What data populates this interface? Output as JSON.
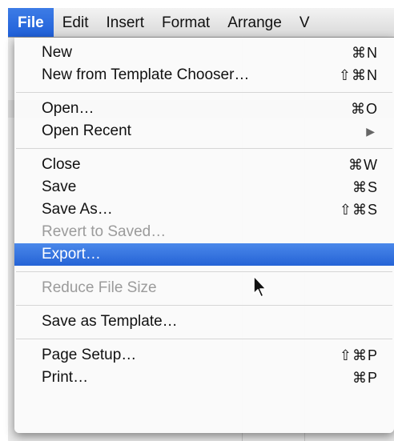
{
  "menubar": {
    "items": [
      "File",
      "Edit",
      "Insert",
      "Format",
      "Arrange",
      "V"
    ],
    "active_index": 0
  },
  "file_menu": {
    "groups": [
      [
        {
          "label": "New",
          "shortcut": "⌘N",
          "enabled": true
        },
        {
          "label": "New from Template Chooser…",
          "shortcut": "⇧⌘N",
          "enabled": true
        }
      ],
      [
        {
          "label": "Open…",
          "shortcut": "⌘O",
          "enabled": true
        },
        {
          "label": "Open Recent",
          "submenu": true,
          "enabled": true
        }
      ],
      [
        {
          "label": "Close",
          "shortcut": "⌘W",
          "enabled": true
        },
        {
          "label": "Save",
          "shortcut": "⌘S",
          "enabled": true
        },
        {
          "label": "Save As…",
          "shortcut": "⇧⌘S",
          "enabled": true
        },
        {
          "label": "Revert to Saved…",
          "enabled": false
        },
        {
          "label": "Export…",
          "enabled": true,
          "highlighted": true
        }
      ],
      [
        {
          "label": "Reduce File Size",
          "enabled": false
        }
      ],
      [
        {
          "label": "Save as Template…",
          "enabled": true
        }
      ],
      [
        {
          "label": "Page Setup…",
          "shortcut": "⇧⌘P",
          "enabled": true
        },
        {
          "label": "Print…",
          "shortcut": "⌘P",
          "enabled": true
        }
      ]
    ]
  },
  "colors": {
    "highlight": "#2563d6",
    "disabled_text": "#9b9b9b"
  },
  "icons": {
    "submenu": "chevron-right-icon",
    "pointer": "arrow-cursor-icon"
  }
}
